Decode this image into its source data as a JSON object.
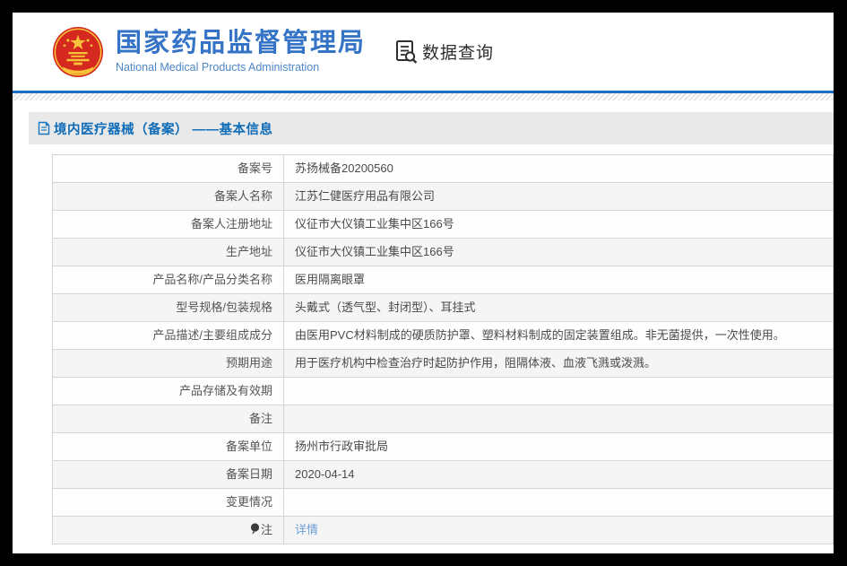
{
  "header": {
    "org_name_zh": "国家药品监督管理局",
    "org_name_en": "National Medical Products Administration",
    "nav_query_label": "数据查询"
  },
  "breadcrumb": {
    "title": "境内医疗器械（备案） ——基本信息"
  },
  "icons": {
    "emblem": "china-national-emblem",
    "nav": "doc-search-icon",
    "breadcrumb": "document-icon",
    "note_row": "note-bulb-icon"
  },
  "colors": {
    "brand_blue": "#3473c5",
    "breadcrumb_blue": "#0f6cb8",
    "link_blue": "#6f9fd9",
    "accent_line": "#1b6ec2",
    "emblem_red": "#d5281e",
    "emblem_gold": "#f7c239"
  },
  "table": {
    "rows": [
      {
        "label": "备案号",
        "value": "苏扬械备20200560"
      },
      {
        "label": "备案人名称",
        "value": "江苏仁健医疗用品有限公司"
      },
      {
        "label": "备案人注册地址",
        "value": "仪征市大仪镇工业集中区166号"
      },
      {
        "label": "生产地址",
        "value": "仪征市大仪镇工业集中区166号"
      },
      {
        "label": "产品名称/产品分类名称",
        "value": "医用隔离眼罩"
      },
      {
        "label": "型号规格/包装规格",
        "value": "头戴式（透气型、封闭型）、耳挂式"
      },
      {
        "label": "产品描述/主要组成成分",
        "value": "由医用PVC材料制成的硬质防护罩、塑料材料制成的固定装置组成。非无菌提供，一次性使用。"
      },
      {
        "label": "预期用途",
        "value": "用于医疗机构中检查治疗时起防护作用，阻隔体液、血液飞溅或泼溅。"
      },
      {
        "label": "产品存储及有效期",
        "value": ""
      },
      {
        "label": "备注",
        "value": ""
      },
      {
        "label": "备案单位",
        "value": "扬州市行政审批局"
      },
      {
        "label": "备案日期",
        "value": "2020-04-14"
      },
      {
        "label": "变更情况",
        "value": ""
      },
      {
        "label": "注",
        "value": "详情",
        "link": true,
        "icon": "note"
      }
    ]
  }
}
